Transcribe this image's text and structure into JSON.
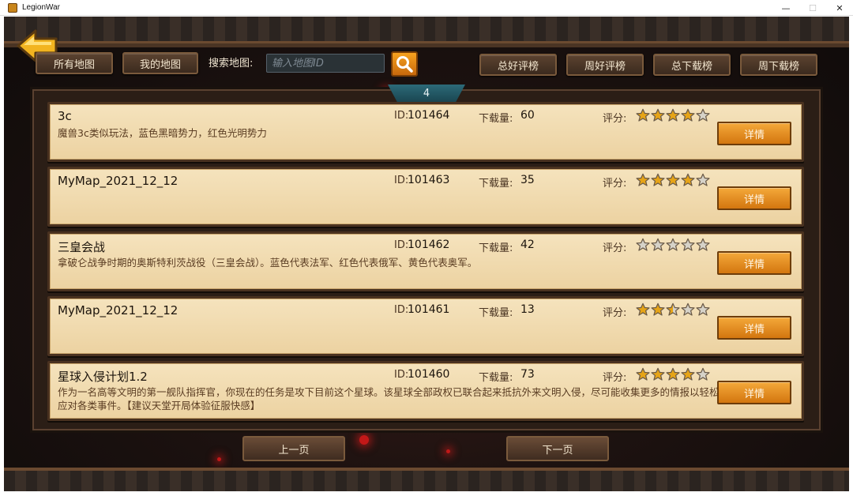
{
  "window": {
    "title": "LegionWar",
    "minimize": "—",
    "maximize": "☐",
    "close": "✕"
  },
  "toolbar": {
    "all_maps": "所有地图",
    "my_maps": "我的地图",
    "search_label": "搜索地图:",
    "search_placeholder": "输入地图ID",
    "rankings": [
      "总好评榜",
      "周好评榜",
      "总下载榜",
      "周下载榜"
    ]
  },
  "page_number": "4",
  "labels": {
    "id": "ID:",
    "downloads": "下载量:",
    "rating": "评分:",
    "detail": "详情"
  },
  "maps": [
    {
      "title": "3c",
      "desc": "魔兽3c类似玩法，蓝色黑暗势力，红色光明势力",
      "id": "101464",
      "downloads": "60",
      "rating": 4
    },
    {
      "title": "MyMap_2021_12_12",
      "desc": "",
      "id": "101463",
      "downloads": "35",
      "rating": 4
    },
    {
      "title": "三皇会战",
      "desc": "拿破仑战争时期的奥斯特利茨战役（三皇会战）。蓝色代表法军、红色代表俄军、黄色代表奥军。",
      "id": "101462",
      "downloads": "42",
      "rating": 0
    },
    {
      "title": "MyMap_2021_12_12",
      "desc": "",
      "id": "101461",
      "downloads": "13",
      "rating": 2.5
    },
    {
      "title": "星球入侵计划1.2",
      "desc": "作为一名高等文明的第一舰队指挥官，你现在的任务是攻下目前这个星球。该星球全部政权已联合起来抵抗外来文明入侵，尽可能收集更多的情报以轻松应对各类事件。【建议天堂开局体验征服快感】",
      "id": "101460",
      "downloads": "73",
      "rating": 4
    }
  ],
  "pager": {
    "prev": "上一页",
    "next": "下一页"
  },
  "colors": {
    "accent_orange": "#e88a1f",
    "card_bg": "#f5e3bd",
    "page_tab": "#2c6a78"
  }
}
